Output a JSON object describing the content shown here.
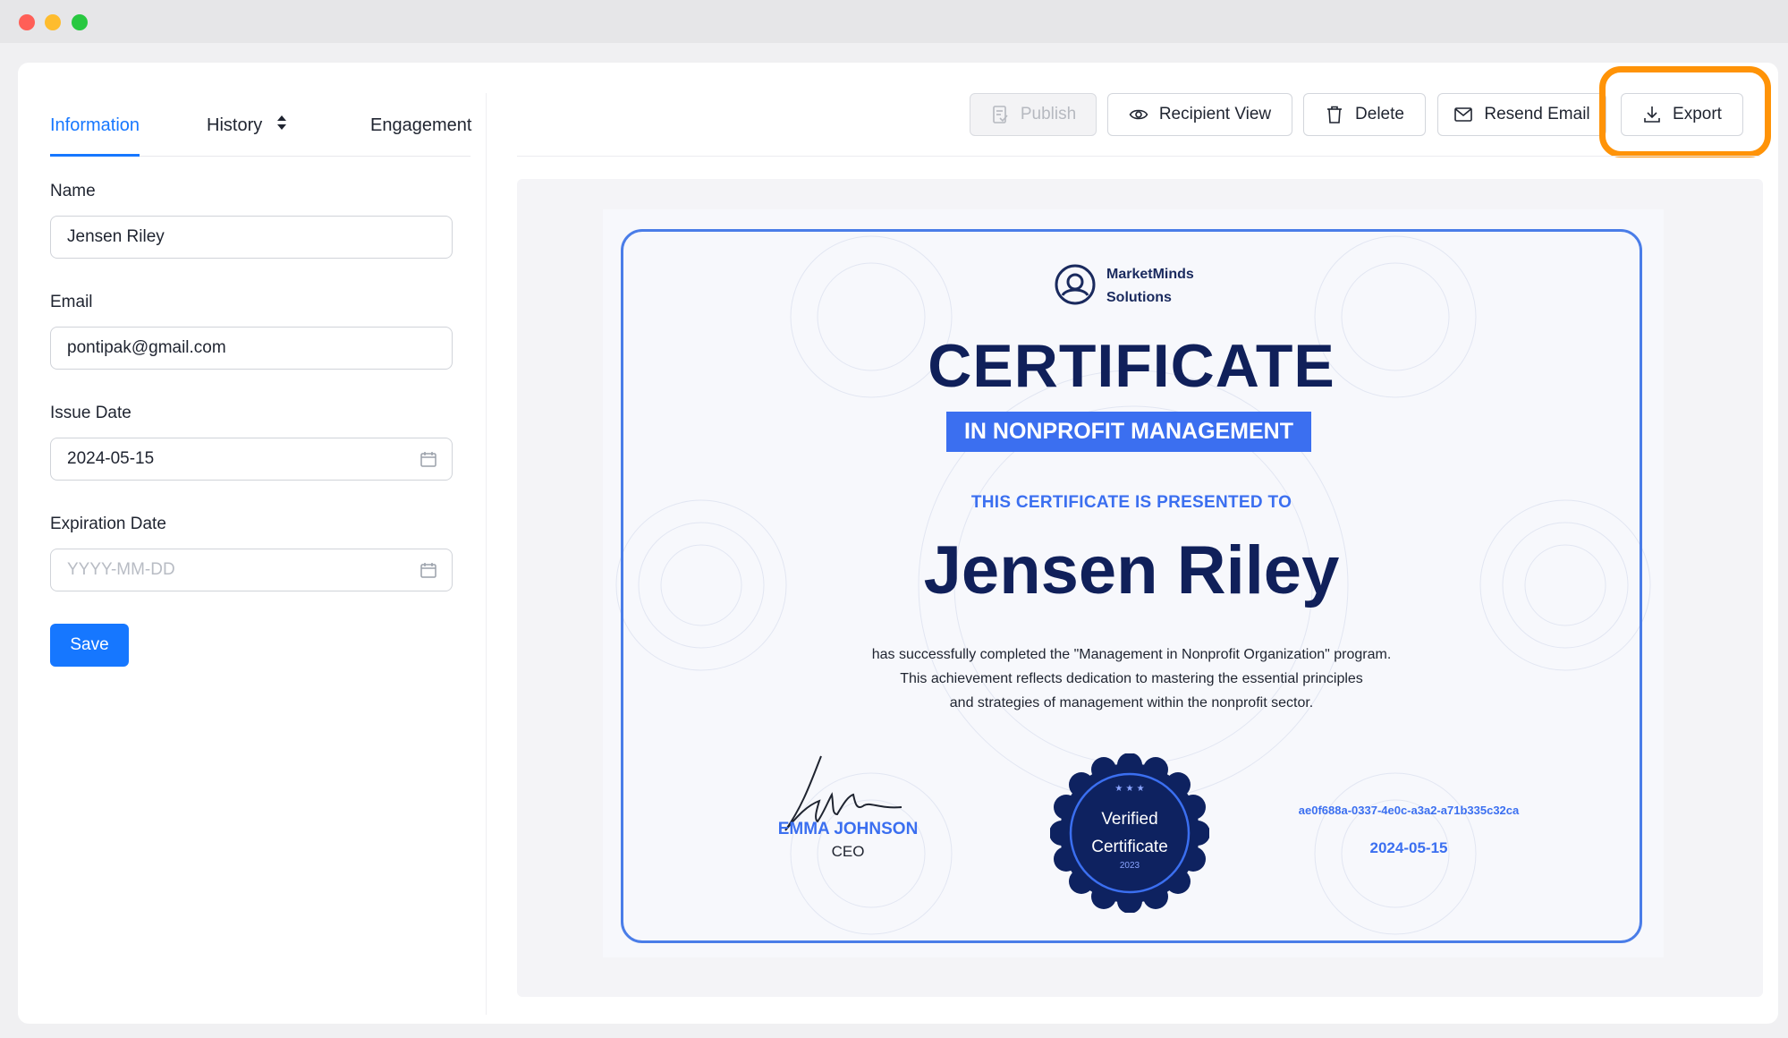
{
  "window": {
    "controls": [
      "close",
      "minimize",
      "maximize"
    ]
  },
  "tabs": [
    {
      "label": "Information",
      "active": true
    },
    {
      "label": "History",
      "icon": "sort-icon"
    },
    {
      "label": "Engagement"
    }
  ],
  "form": {
    "name": {
      "label": "Name",
      "value": "Jensen Riley"
    },
    "email": {
      "label": "Email",
      "value": "pontipak@gmail.com"
    },
    "issue_date": {
      "label": "Issue Date",
      "value": "2024-05-15",
      "icon": "calendar-icon"
    },
    "expiration_date": {
      "label": "Expiration Date",
      "value": "",
      "placeholder": "YYYY-MM-DD",
      "icon": "calendar-icon"
    },
    "save_label": "Save"
  },
  "toolbar": {
    "publish": {
      "label": "Publish",
      "icon": "document-icon",
      "disabled": true
    },
    "recipient_view": {
      "label": "Recipient View",
      "icon": "eye-icon"
    },
    "delete": {
      "label": "Delete",
      "icon": "trash-icon"
    },
    "resend_email": {
      "label": "Resend Email",
      "icon": "mail-icon"
    },
    "export": {
      "label": "Export",
      "icon": "download-icon",
      "highlighted": true
    }
  },
  "certificate": {
    "brand_line1": "MarketMinds",
    "brand_line2": "Solutions",
    "title": "CERTIFICATE",
    "subtitle": "IN NONPROFIT MANAGEMENT",
    "presented_to": "THIS CERTIFICATE IS PRESENTED TO",
    "recipient_name": "Jensen Riley",
    "body_line1": "has successfully completed the \"Management in Nonprofit Organization\" program.",
    "body_line2": "This achievement reflects dedication to mastering the essential principles",
    "body_line3": "and strategies of management within the nonprofit sector.",
    "signer_name": "EMMA JOHNSON",
    "signer_role": "CEO",
    "seal_line1": "Verified",
    "seal_line2": "Certificate",
    "seal_year": "2023",
    "certificate_id": "ae0f688a-0337-4e0c-a3a2-a71b335c32ca",
    "issue_date": "2024-05-15"
  },
  "colors": {
    "accent": "#1677ff",
    "highlight": "#ff9307",
    "cert_navy": "#10205a",
    "cert_blue": "#3b6ff0"
  }
}
